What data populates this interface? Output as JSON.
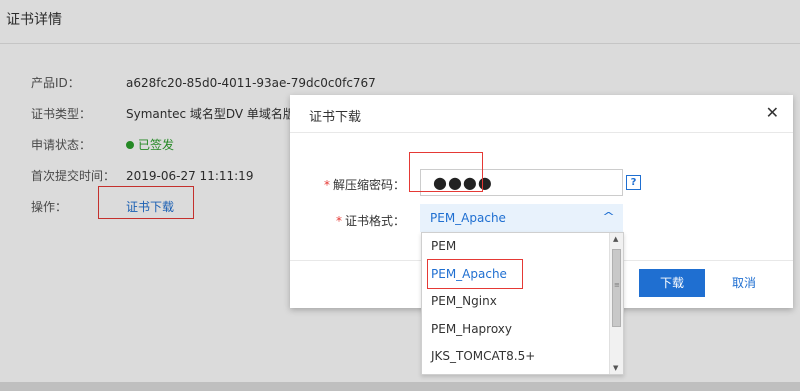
{
  "page": {
    "title": "证书详情",
    "fields": [
      {
        "label": "产品ID：",
        "value": "a628fc20-85d0-4011-93ae-79dc0c0fc767"
      },
      {
        "label": "证书类型：",
        "value": "Symantec 域名型DV 单域名版"
      },
      {
        "label": "申请状态：",
        "value": "已签发"
      },
      {
        "label": "首次提交时间：",
        "value": "2019-06-27 11:11:19"
      },
      {
        "label": "操作：",
        "value": "证书下载"
      }
    ]
  },
  "modal": {
    "title": "证书下载",
    "close_icon": "close-icon",
    "password_label": "解压缩密码：",
    "password_value": "●●●●",
    "help_icon_text": "?",
    "format_label": "证书格式：",
    "format_selected": "PEM_Apache",
    "confirm_label": "下载",
    "cancel_label": "取消"
  },
  "dropdown": {
    "options": [
      "PEM",
      "PEM_Apache",
      "PEM_Nginx",
      "PEM_Haproxy",
      "JKS_TOMCAT8.5+"
    ],
    "selected": "PEM_Apache"
  },
  "colors": {
    "accent": "#1f6fd1",
    "status_green": "#2ca02c",
    "highlight_red": "#e53935"
  }
}
